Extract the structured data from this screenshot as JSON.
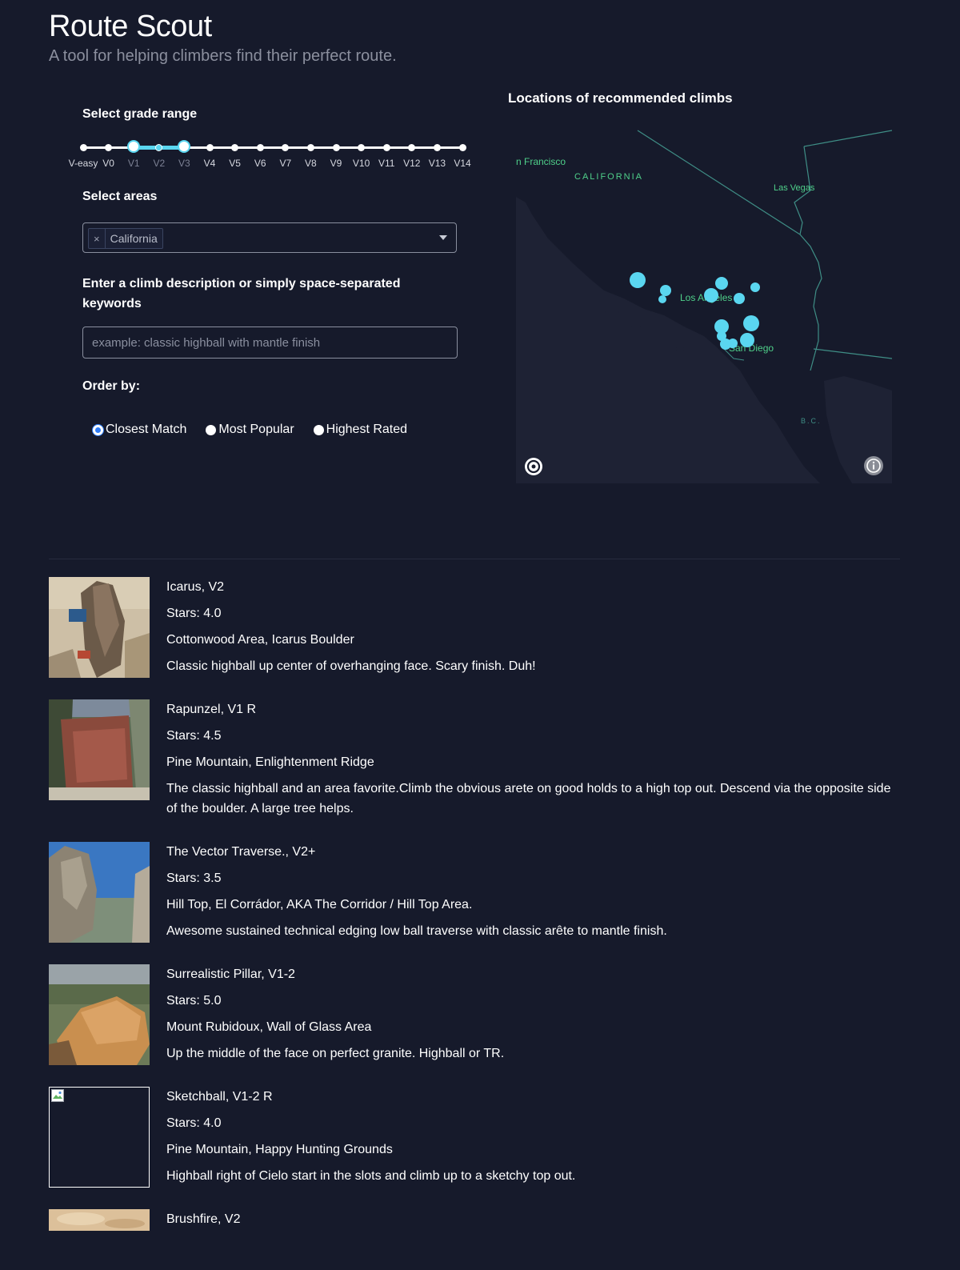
{
  "header": {
    "title": "Route Scout",
    "subtitle": "A tool for helping climbers find their perfect route."
  },
  "filters": {
    "grade_label": "Select grade range",
    "grades": [
      "V-easy",
      "V0",
      "V1",
      "V2",
      "V3",
      "V4",
      "V5",
      "V6",
      "V7",
      "V8",
      "V9",
      "V10",
      "V11",
      "V12",
      "V13",
      "V14"
    ],
    "grade_range_selected": [
      "V1",
      "V3"
    ],
    "areas_label": "Select areas",
    "selected_areas": [
      "California"
    ],
    "remove_chip_glyph": "×",
    "description_label": "Enter a climb description or simply space-separated keywords",
    "description_placeholder": "example: classic highball with mantle finish",
    "description_value": "",
    "order_label": "Order by:",
    "order_options": [
      "Closest Match",
      "Most Popular",
      "Highest Rated"
    ],
    "order_selected": "Closest Match"
  },
  "map": {
    "title": "Locations of recommended climbs",
    "place_labels": {
      "san_francisco": "n Francisco",
      "california": "CALIFORNIA",
      "las_vegas": "Las Vegas",
      "los_angeles": "Los Angeles",
      "san_diego": "San Diego",
      "baja": "B.C."
    },
    "marker_color": "#5ad6f0",
    "label_color": "#4fd08a"
  },
  "results": [
    {
      "name_grade": "Icarus, V2",
      "stars": "Stars: 4.0",
      "location": "Cottonwood Area, Icarus Boulder",
      "description": "Classic highball up center of overhanging face. Scary finish. Duh!",
      "image": "boulder-photo"
    },
    {
      "name_grade": "Rapunzel, V1 R",
      "stars": "Stars: 4.5",
      "location": "Pine Mountain, Enlightenment Ridge",
      "description": "The classic highball and an area favorite.Climb the obvious arete on good holds to a high top out. Descend via the opposite side of the boulder. A large tree helps.",
      "image": "boulder-photo"
    },
    {
      "name_grade": "The Vector Traverse., V2+",
      "stars": "Stars: 3.5",
      "location": "Hill Top, El Corrádor, AKA The Corridor / Hill Top Area.",
      "description": "Awesome sustained technical edging low ball traverse with classic arête to mantle finish.",
      "image": "boulder-photo"
    },
    {
      "name_grade": "Surrealistic Pillar, V1-2",
      "stars": "Stars: 5.0",
      "location": "Mount Rubidoux, Wall of Glass Area",
      "description": "Up the middle of the face on perfect granite. Highball or TR.",
      "image": "boulder-photo"
    },
    {
      "name_grade": "Sketchball, V1-2 R",
      "stars": "Stars: 4.0",
      "location": "Pine Mountain, Happy Hunting Grounds",
      "description": "Highball right of Cielo start in the slots and climb up to a sketchy top out.",
      "image": "broken-image-icon"
    },
    {
      "name_grade": "Brushfire, V2",
      "image": "boulder-photo"
    }
  ],
  "colors": {
    "background": "#161a2b",
    "accent": "#5ad6f0",
    "radio_selected": "#2f7cf6"
  }
}
